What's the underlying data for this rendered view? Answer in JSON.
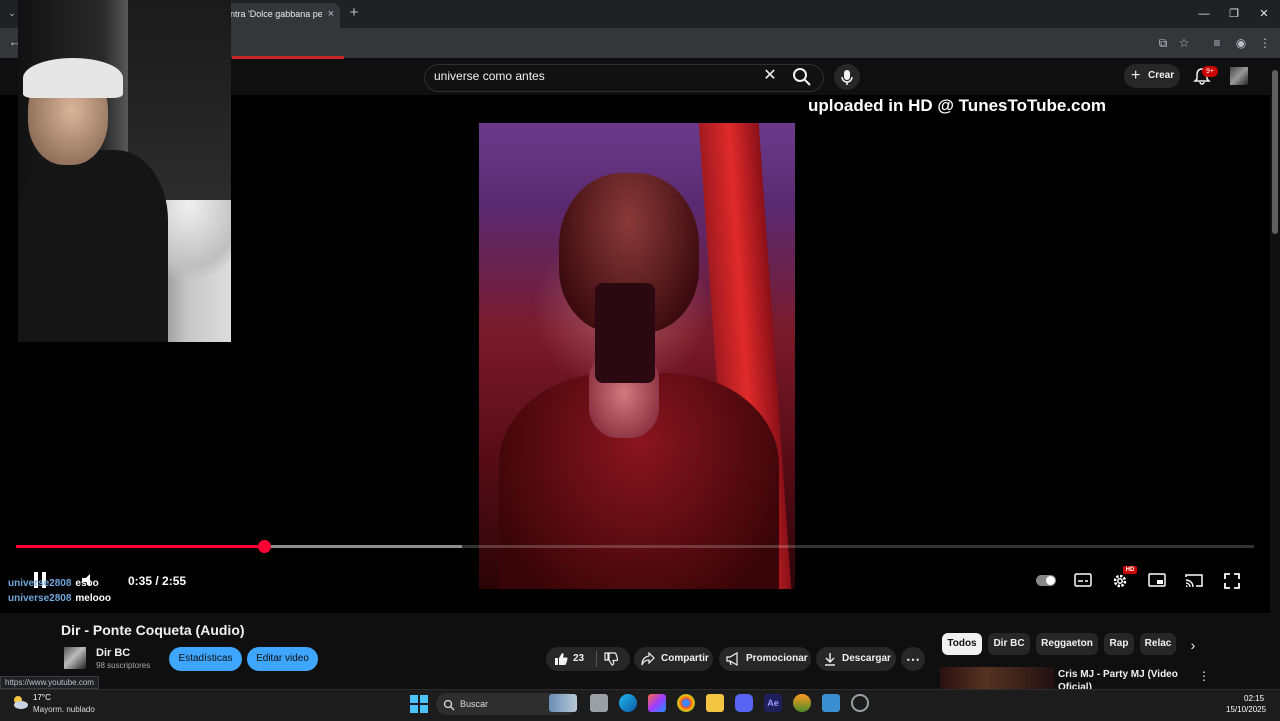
{
  "browser": {
    "tab_title": "ntra 'Dolce gabbana peru",
    "tab_close": "×",
    "new_tab": "+",
    "window_controls": {
      "minimize": "—",
      "maximize": "❐",
      "close": "✕"
    },
    "status_url": "https://www.youtube.com"
  },
  "masthead": {
    "search_value": "universe como antes",
    "create_label": "Crear",
    "notifications_badge": "9+"
  },
  "player": {
    "watermark": "uploaded in HD @ TunesToTube.com",
    "time": "0:35 / 2:55",
    "progress_fraction": 0.2,
    "buffer_fraction": 0.36,
    "hd_badge": "HD",
    "chat": [
      {
        "user": "universe2808",
        "message": "esoo"
      },
      {
        "user": "universe2808",
        "message": "melooo"
      }
    ]
  },
  "video": {
    "title": "Dir - Ponte Coqueta (Audio)",
    "channel_name": "Dir BC",
    "subscribers": "98 suscriptores",
    "stats_button": "Estadísticas",
    "edit_button": "Editar video",
    "likes": "23",
    "share_label": "Compartir",
    "promote_label": "Promocionar",
    "download_label": "Descargar"
  },
  "chips": [
    "Todos",
    "Dir BC",
    "Reggaeton",
    "Rap",
    "Relac"
  ],
  "recommendation": {
    "title": "Cris MJ - Party MJ (Video Oficial)"
  },
  "taskbar": {
    "weather_temp": "17°C",
    "weather_desc": "Mayorm. nublado",
    "search_placeholder": "Buscar",
    "time": "02:15",
    "date": "15/10/2025"
  },
  "colors": {
    "accent_red": "#ff0033",
    "blue_button": "#3ea6ff",
    "background": "#0f0f0f"
  }
}
